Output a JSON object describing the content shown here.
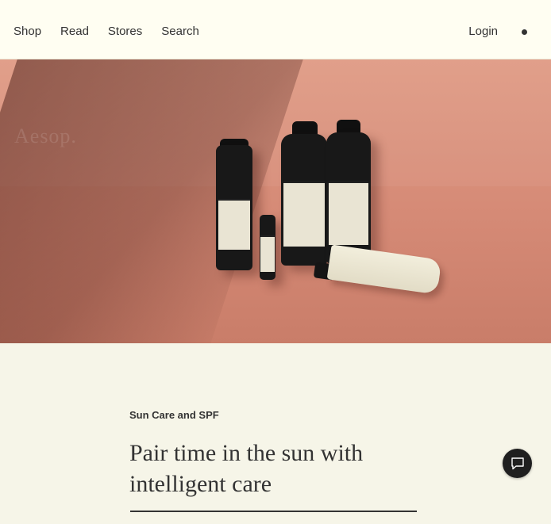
{
  "nav": {
    "left_items": [
      "Shop",
      "Read",
      "Stores",
      "Search"
    ],
    "login_label": "Login"
  },
  "hero": {
    "background_brand": "Aesop."
  },
  "content": {
    "eyebrow": "Sun Care and SPF",
    "title": "Pair time in the sun with intelligent care"
  },
  "colors": {
    "header_bg": "#fffef2",
    "page_bg": "#f6f5e8",
    "text": "#333333",
    "hero_bg": "#d58a76",
    "chat_button": "#1f1f1f"
  },
  "icons": {
    "cart_indicator": "dot-icon",
    "chat": "chat-bubble-icon"
  }
}
